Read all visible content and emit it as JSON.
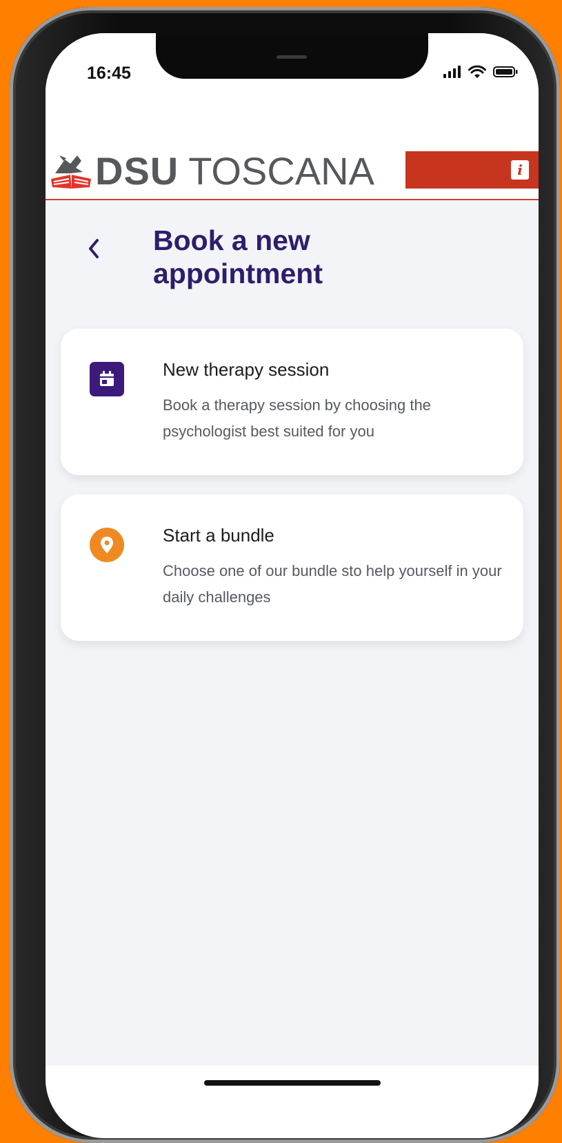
{
  "status_bar": {
    "time": "16:45",
    "icons": [
      "signal-icon",
      "wifi-icon",
      "battery-icon"
    ]
  },
  "header": {
    "brand_bold": "DSU",
    "brand_light": "TOSCANA",
    "info_label": "i",
    "colors": {
      "brand_text": "#56595c",
      "brand_red": "#c8351f"
    }
  },
  "page": {
    "title": "Book a new appointment",
    "back_icon": "chevron-left-icon"
  },
  "options": [
    {
      "icon": "calendar-icon",
      "title": "New therapy session",
      "description": "Book a therapy session by choosing the psychologist best suited for you",
      "icon_color": "#3c1a7a"
    },
    {
      "icon": "map-pin-icon",
      "title": "Start a bundle",
      "description": "Choose one of our bundle sto help yourself in your daily challenges",
      "icon_color": "#ef8a22"
    }
  ],
  "theme": {
    "title_color": "#2f1d6b",
    "background": "#f2f4f7",
    "device_frame_bg": "#ff7f00"
  }
}
